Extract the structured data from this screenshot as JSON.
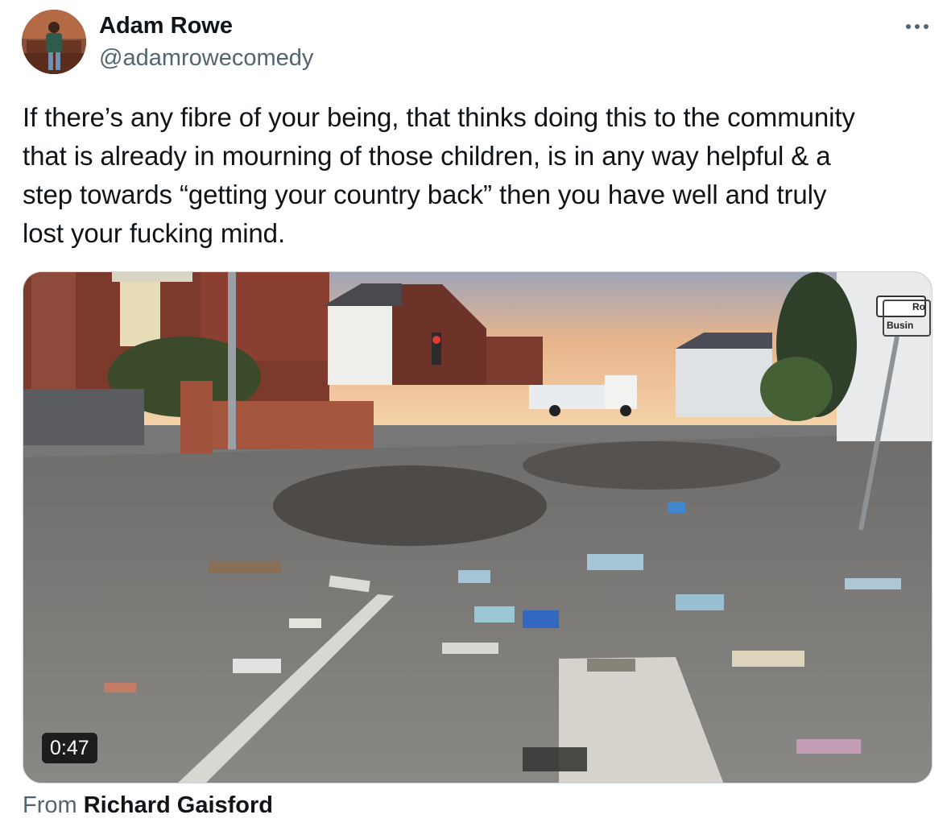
{
  "author": {
    "display_name": "Adam Rowe",
    "handle": "@adamrowecomedy"
  },
  "tweet": {
    "text_lines": [
      "If there’s any fibre of your being, that thinks doing this to the community",
      "that is already in mourning of those children, is in any way helpful & a",
      "step towards “getting your country back” then you have well and truly",
      "lost your fucking mind."
    ]
  },
  "media": {
    "duration": "0:47",
    "sign_lines": [
      "Ro",
      "Busin"
    ]
  },
  "attribution": {
    "from_label": "From",
    "source_name": "Richard Gaisford"
  },
  "icons": {
    "more": "more-horizontal-icon"
  }
}
